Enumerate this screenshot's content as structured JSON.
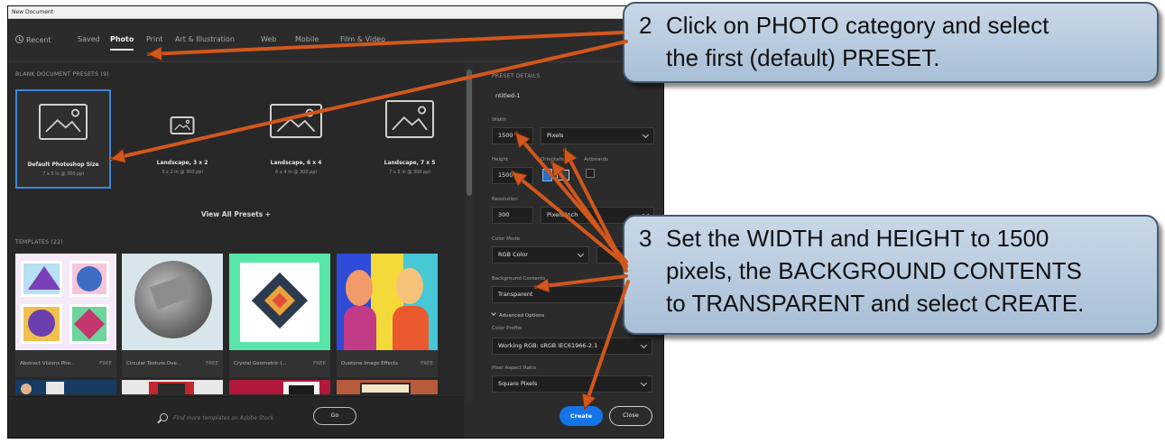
{
  "window": {
    "title": "New Document"
  },
  "tabs": [
    {
      "label": "Recent",
      "icon": "clock-icon"
    },
    {
      "label": "Saved"
    },
    {
      "label": "Photo",
      "active": true
    },
    {
      "label": "Print"
    },
    {
      "label": "Art & Illustration"
    },
    {
      "label": "Web"
    },
    {
      "label": "Mobile"
    },
    {
      "label": "Film & Video"
    }
  ],
  "presets": {
    "header": "BLANK DOCUMENT PRESETS (9)",
    "items": [
      {
        "name": "Default Photoshop Size",
        "size": "7 x 5 in @ 300 ppi"
      },
      {
        "name": "Landscape, 3 x 2",
        "size": "3 x 2 in @ 300 ppi"
      },
      {
        "name": "Landscape, 6 x 4",
        "size": "6 x 4 in @ 300 ppi"
      },
      {
        "name": "Landscape, 7 x 5",
        "size": "7 x 5 in @ 300 ppi"
      }
    ],
    "view_all": "View All Presets +"
  },
  "templates": {
    "header": "TEMPLATES (22)",
    "items": [
      {
        "name": "Abstract Visions Pho...",
        "badge": "FREE"
      },
      {
        "name": "Circular Texture Ove...",
        "badge": "FREE"
      },
      {
        "name": "Crystal Geometric I...",
        "badge": "FREE"
      },
      {
        "name": "Duotone Image Effects",
        "badge": "FREE"
      }
    ]
  },
  "search": {
    "placeholder": "Find more templates on Adobe Stock",
    "go_label": "Go"
  },
  "details": {
    "header": "PRESET DETAILS",
    "name": "ntitled-1",
    "width_label": "Width",
    "width_value": "1500",
    "width_unit": "Pixels",
    "height_label": "Height",
    "height_value": "1500",
    "orientation_label": "Orientation",
    "artboards_label": "Artboards",
    "resolution_label": "Resolution",
    "resolution_value": "300",
    "resolution_unit": "Pixels/Inch",
    "color_mode_label": "Color Mode",
    "color_mode_value": "RGB Color",
    "bg_contents_label": "Background Contents",
    "bg_contents_value": "Transparent",
    "advanced_label": "Advanced Options",
    "color_profile_label": "Color Profile",
    "color_profile_value": "Working RGB: sRGB IEC61966-2.1",
    "pixel_ratio_label": "Pixel Aspect Ratio",
    "pixel_ratio_value": "Square Pixels",
    "create_label": "Create",
    "close_label": "Close"
  },
  "callouts": [
    {
      "number": "2",
      "text": "Click on PHOTO category and select\nthe first (default) PRESET."
    },
    {
      "number": "3",
      "text": "Set the WIDTH and HEIGHT to 1500\npixels, the BACKGROUND CONTENTS\nto TRANSPARENT and select CREATE."
    }
  ],
  "colors": {
    "accent": "#1473e6",
    "arrow": "#d2571c",
    "callout_fill": "#bccde0",
    "dialog_bg": "#2b2b2b"
  }
}
